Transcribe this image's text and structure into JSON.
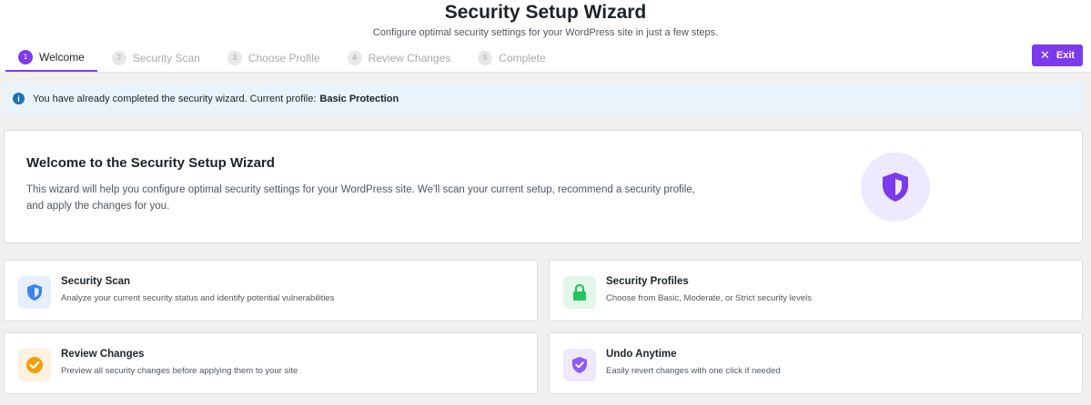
{
  "header": {
    "title": "Security Setup Wizard",
    "subtitle": "Configure optimal security settings for your WordPress site in just a few steps."
  },
  "steps": [
    {
      "num": "1",
      "label": "Welcome",
      "active": true
    },
    {
      "num": "2",
      "label": "Security Scan"
    },
    {
      "num": "3",
      "label": "Choose Profile"
    },
    {
      "num": "4",
      "label": "Review Changes"
    },
    {
      "num": "5",
      "label": "Complete"
    }
  ],
  "exit_label": "Exit",
  "notice": {
    "text": "You have already completed the security wizard. Current profile:",
    "profile": "Basic Protection"
  },
  "welcome": {
    "title": "Welcome to the Security Setup Wizard",
    "text": "This wizard will help you configure optimal security settings for your WordPress site. We'll scan your current setup, recommend a security profile, and apply the changes for you."
  },
  "features": [
    {
      "title": "Security Scan",
      "desc": "Analyze your current security status and identify potential vulnerabilities",
      "icon": "shield-icon",
      "color": "#3b82f6"
    },
    {
      "title": "Security Profiles",
      "desc": "Choose from Basic, Moderate, or Strict security levels",
      "icon": "lock-icon",
      "color": "#22c55e"
    },
    {
      "title": "Review Changes",
      "desc": "Preview all security changes before applying them to your site",
      "icon": "check-circle-icon",
      "color": "#f59e0b"
    },
    {
      "title": "Undo Anytime",
      "desc": "Easily revert changes with one click if needed",
      "icon": "shield-check-icon",
      "color": "#8b5cf6"
    }
  ],
  "colors": {
    "accent": "#7c3aed",
    "notice_bg": "#e8f3fc",
    "info": "#2271b1"
  }
}
